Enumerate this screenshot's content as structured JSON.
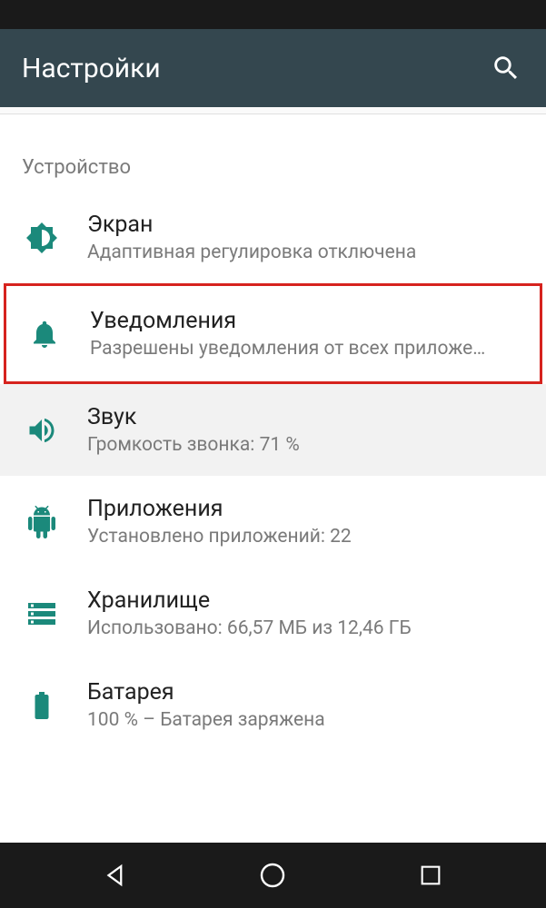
{
  "header": {
    "title": "Настройки"
  },
  "section": {
    "label": "Устройство"
  },
  "items": {
    "display": {
      "title": "Экран",
      "subtitle": "Адаптивная регулировка отключена"
    },
    "notifications": {
      "title": "Уведомления",
      "subtitle": "Разрешены уведомления от всех приложе…"
    },
    "sound": {
      "title": "Звук",
      "subtitle": "Громкость звонка: 71 %"
    },
    "apps": {
      "title": "Приложения",
      "subtitle": "Установлено приложений: 22"
    },
    "storage": {
      "title": "Хранилище",
      "subtitle": "Использовано: 66,57 МБ из 12,46 ГБ"
    },
    "battery": {
      "title": "Батарея",
      "subtitle": "100 % – Батарея заряжена"
    }
  },
  "colors": {
    "accent": "#1b897b",
    "highlight_border": "#d6231e",
    "appbar": "#34474f"
  }
}
